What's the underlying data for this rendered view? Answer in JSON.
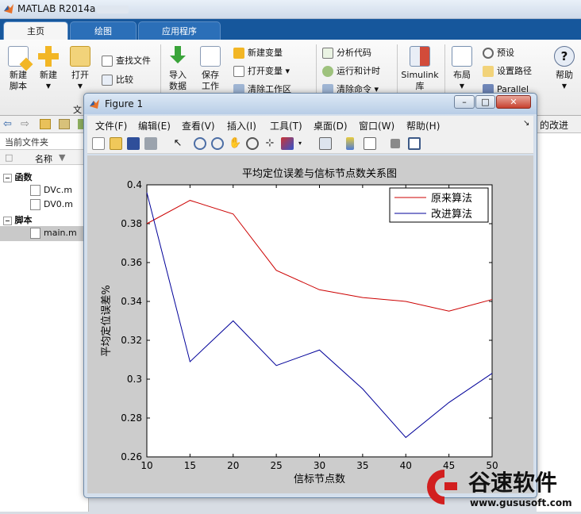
{
  "app": {
    "title": "MATLAB R2014a",
    "tabs": [
      {
        "label": "主页"
      },
      {
        "label": "绘图"
      },
      {
        "label": "应用程序"
      }
    ],
    "ribbon": {
      "new_script": "新建脚本",
      "new": "新建",
      "open": "打开",
      "find_files": "查找文件",
      "compare": "比较",
      "import_data": "导入数据",
      "save_workspace": "保存工作区",
      "new_variable": "新建变量",
      "open_variable": "打开变量",
      "clear_workspace": "清除工作区",
      "analyze_code": "分析代码",
      "run_and_time": "运行和计时",
      "clear_commands": "清除命令",
      "simulink": "Simulink库",
      "layout": "布局",
      "preferences": "预设",
      "set_path": "设置路径",
      "parallel": "Parallel",
      "help": "帮助",
      "file_group_fragment": "文"
    },
    "current_folder": {
      "title": "当前文件夹",
      "name_header": "名称",
      "groups": [
        {
          "label": "函数",
          "files": [
            "DVc.m",
            "DV0.m"
          ]
        },
        {
          "label": "脚本",
          "files": [
            "main.m"
          ]
        }
      ]
    },
    "right_fragment": "的改进"
  },
  "figure": {
    "window_title": "Figure 1",
    "menu": [
      "文件(F)",
      "编辑(E)",
      "查看(V)",
      "插入(I)",
      "工具(T)",
      "桌面(D)",
      "窗口(W)",
      "帮助(H)"
    ]
  },
  "chart_data": {
    "type": "line",
    "title": "平均定位误差与信标节点数关系图",
    "xlabel": "信标节点数",
    "ylabel": "平均定位误差%",
    "x": [
      10,
      15,
      20,
      25,
      30,
      35,
      40,
      45,
      50
    ],
    "xlim": [
      10,
      50
    ],
    "ylim": [
      0.26,
      0.4
    ],
    "xticks": [
      10,
      15,
      20,
      25,
      30,
      35,
      40,
      45,
      50
    ],
    "yticks": [
      0.26,
      0.28,
      0.3,
      0.32,
      0.34,
      0.36,
      0.38,
      0.4
    ],
    "legend_position": "top-right",
    "grid": false,
    "series": [
      {
        "name": "原来算法",
        "color": "#cc0000",
        "values": [
          0.38,
          0.392,
          0.385,
          0.356,
          0.346,
          0.342,
          0.34,
          0.335,
          0.341
        ]
      },
      {
        "name": "改进算法",
        "color": "#000099",
        "values": [
          0.396,
          0.309,
          0.33,
          0.307,
          0.315,
          0.295,
          0.27,
          0.288,
          0.303
        ]
      }
    ]
  },
  "watermark": {
    "brand": "谷速软件",
    "url": "www.gususoft.com",
    "color": "#d21f1f"
  }
}
